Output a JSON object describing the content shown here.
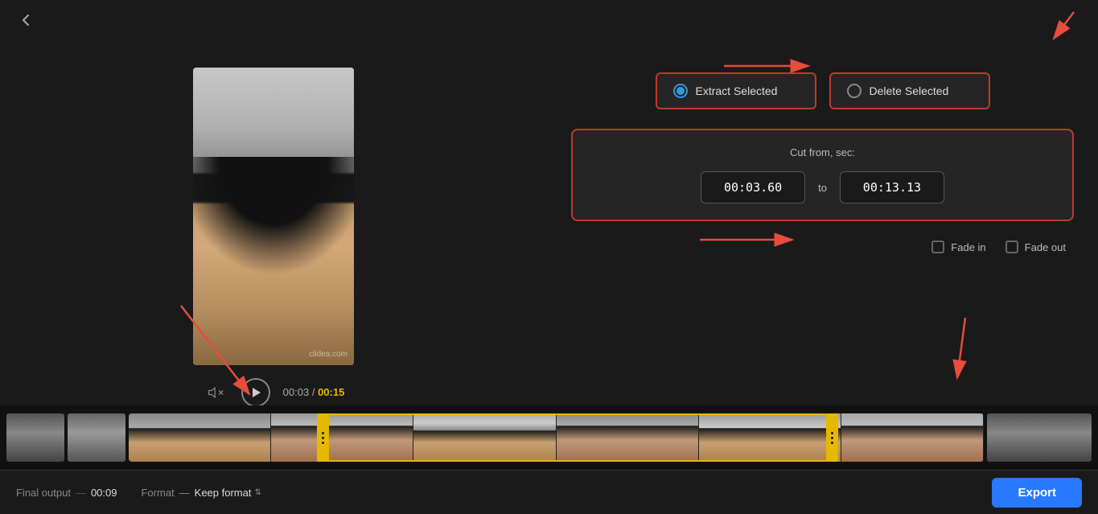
{
  "app": {
    "back_icon": "‹"
  },
  "toolbar": {
    "extract_label": "Extract Selected",
    "delete_label": "Delete Selected"
  },
  "cut_section": {
    "title": "Cut from, sec:",
    "from_value": "00:03.60",
    "to_label": "to",
    "to_value": "00:13.13"
  },
  "fade": {
    "fade_in_label": "Fade in",
    "fade_out_label": "Fade out"
  },
  "controls": {
    "current_time": "00:03",
    "separator": "/",
    "total_time": "00:15"
  },
  "bottom_bar": {
    "final_output_label": "Final output",
    "dash": "—",
    "duration": "00:09",
    "format_label": "Format",
    "format_dash": "—",
    "format_value": "Keep format",
    "export_label": "Export"
  },
  "watermark": "clidea.com"
}
